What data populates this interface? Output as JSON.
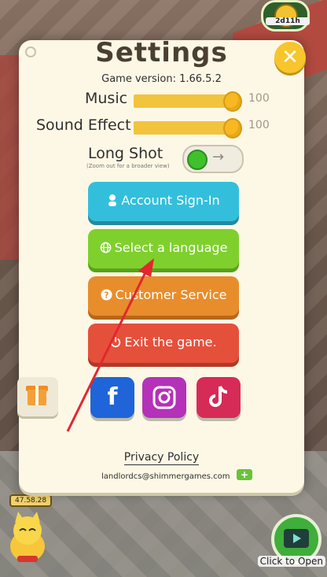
{
  "background": {
    "top_badge_text": "2d11h",
    "timer_text": "47.58.28",
    "tv_label": "Click to Open"
  },
  "dialog": {
    "title": "Settings",
    "close_symbol": "✕",
    "version": "Game version: 1.66.5.2",
    "music": {
      "label": "Music",
      "value": "100",
      "level": 100
    },
    "sound_effect": {
      "label": "Sound Effect",
      "value": "100",
      "level": 100
    },
    "long_shot": {
      "label": "Long Shot",
      "sub": "(Zoom out for a broader view)",
      "arrow": "→",
      "on": true
    },
    "buttons": {
      "account": {
        "label": "Account Sign-In",
        "icon": "person-icon"
      },
      "language": {
        "label": "Select a language",
        "icon": "globe-icon"
      },
      "service": {
        "label": "Customer Service",
        "icon": "question-icon"
      },
      "exit": {
        "label": "Exit the game.",
        "icon": "power-icon"
      }
    },
    "social": [
      "facebook-icon",
      "instagram-icon",
      "tiktok-icon"
    ],
    "privacy": "Privacy Policy",
    "email": "landlordcs@shimmergames.com",
    "copy_symbol": "+"
  },
  "colors": {
    "blue": "#33bfdc",
    "green": "#7fd02d",
    "orange": "#e88d2c",
    "red": "#e5503b",
    "arrow": "#e3262f"
  }
}
